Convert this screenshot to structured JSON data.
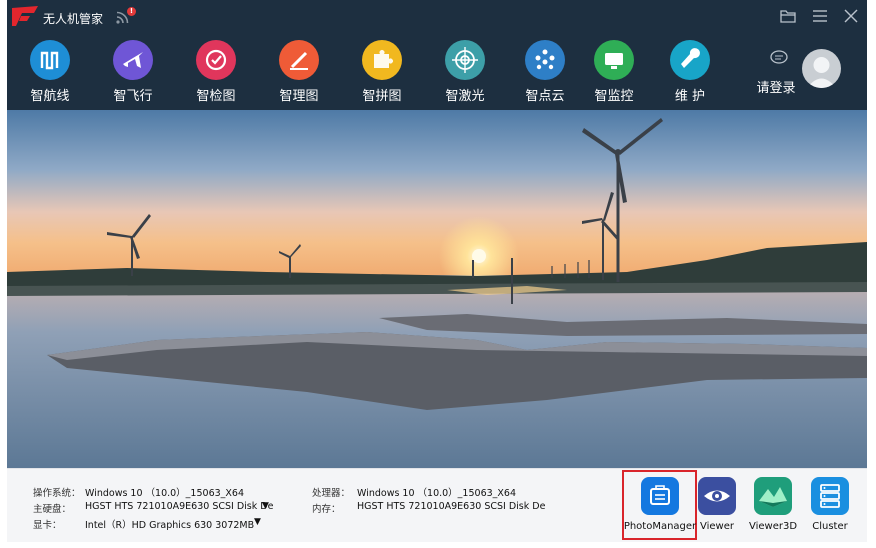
{
  "titlebar": {
    "app_title": "无人机管家",
    "badge": "!",
    "brand_color": "#e3262d"
  },
  "nav": {
    "items": [
      {
        "label": "智航线",
        "icon": "route-icon",
        "color": "#1e8ed6"
      },
      {
        "label": "智飞行",
        "icon": "plane-icon",
        "color": "#6f56d6"
      },
      {
        "label": "智检图",
        "icon": "check-image-icon",
        "color": "#e0365c"
      },
      {
        "label": "智理图",
        "icon": "edit-map-icon",
        "color": "#ef5b37"
      },
      {
        "label": "智拼图",
        "icon": "puzzle-icon",
        "color": "#f1b81f"
      },
      {
        "label": "智激光",
        "icon": "laser-target-icon",
        "color": "#3d9fa8"
      },
      {
        "label": "智点云",
        "icon": "point-cloud-icon",
        "color": "#2e7fc7"
      },
      {
        "label": "智监控",
        "icon": "monitor-icon",
        "color": "#2fae56"
      },
      {
        "label": "维  护",
        "icon": "wrench-icon",
        "color": "#18a5c8"
      }
    ],
    "login_label": "请登录"
  },
  "system_info": {
    "os_label": "操作系统：",
    "os_value": "Windows 10 （10.0）_15063_X64",
    "disk_label": "主硬盘：",
    "disk_value": "HGST HTS 721010A9E630 SCSI Disk De",
    "gpu_label": "显卡：",
    "gpu_value": "Intel（R）HD Graphics 630 3072MB",
    "cpu_label": "处理器：",
    "cpu_value": "Windows 10 （10.0）_15063_X64",
    "mem_label": "内存：",
    "mem_value": "HGST HTS 721010A9E630 SCSI Disk De"
  },
  "apps": [
    {
      "label": "PhotoManager",
      "icon": "photo-manager-icon",
      "color": "#1478e0"
    },
    {
      "label": "Viewer",
      "icon": "eye-icon",
      "color": "#3b4fa0"
    },
    {
      "label": "Viewer3D",
      "icon": "terrain-3d-icon",
      "color": "#1f9e7b"
    },
    {
      "label": "Cluster",
      "icon": "server-cluster-icon",
      "color": "#1a8fe0"
    }
  ],
  "selected_app": "PhotoManager"
}
